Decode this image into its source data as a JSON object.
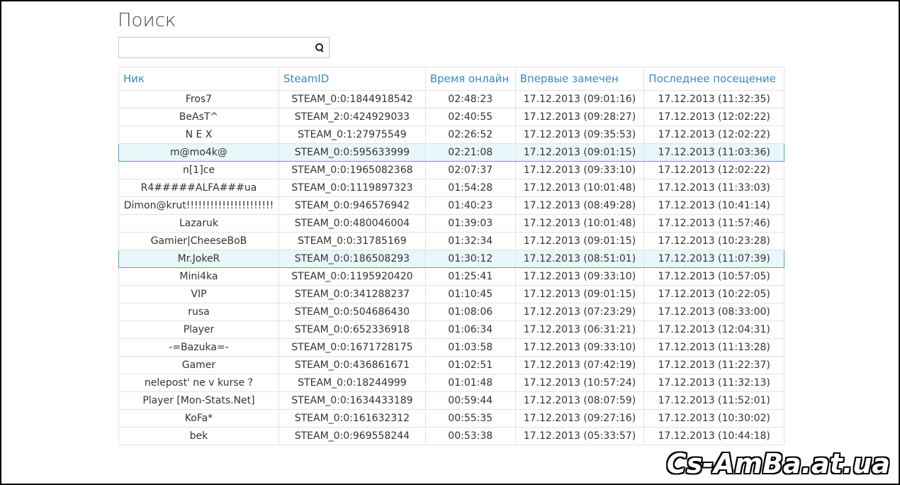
{
  "page": {
    "title": "Поиск"
  },
  "search": {
    "value": "",
    "placeholder": "",
    "icon": "search-icon"
  },
  "table": {
    "headers": [
      "Ник",
      "SteamID",
      "Время онлайн",
      "Впервые замечен",
      "Последнее посещение"
    ],
    "rows": [
      [
        "Fros7",
        "STEAM_0:0:1844918542",
        "02:48:23",
        "17.12.2013 (09:01:16)",
        "17.12.2013 (11:32:35)"
      ],
      [
        "BeAsT^",
        "STEAM_2:0:424929033",
        "02:40:55",
        "17.12.2013 (09:28:27)",
        "17.12.2013 (12:02:22)"
      ],
      [
        "N E X",
        "STEAM_0:1:27975549",
        "02:26:52",
        "17.12.2013 (09:35:53)",
        "17.12.2013 (12:02:22)"
      ],
      [
        "m@mo4k@",
        "STEAM_0:0:595633999",
        "02:21:08",
        "17.12.2013 (09:01:15)",
        "17.12.2013 (11:03:36)"
      ],
      [
        "n[1]ce",
        "STEAM_0:0:1965082368",
        "02:07:37",
        "17.12.2013 (09:33:10)",
        "17.12.2013 (12:02:22)"
      ],
      [
        "R4#####ALFA###ua",
        "STEAM_0:0:1119897323",
        "01:54:28",
        "17.12.2013 (10:01:48)",
        "17.12.2013 (11:33:03)"
      ],
      [
        "Dimon@krut!!!!!!!!!!!!!!!!!!!!!!",
        "STEAM_0:0:946576942",
        "01:40:23",
        "17.12.2013 (08:49:28)",
        "17.12.2013 (10:41:14)"
      ],
      [
        "Lazaruk",
        "STEAM_0:0:480046004",
        "01:39:03",
        "17.12.2013 (10:01:48)",
        "17.12.2013 (11:57:46)"
      ],
      [
        "Gamier|CheeseBoB",
        "STEAM_0:0:31785169",
        "01:32:34",
        "17.12.2013 (09:01:15)",
        "17.12.2013 (10:23:28)"
      ],
      [
        "Mr.JokeR",
        "STEAM_0:0:186508293",
        "01:30:12",
        "17.12.2013 (08:51:01)",
        "17.12.2013 (11:07:39)"
      ],
      [
        "Mini4ka",
        "STEAM_0:0:1195920420",
        "01:25:41",
        "17.12.2013 (09:33:10)",
        "17.12.2013 (10:57:05)"
      ],
      [
        "VIP",
        "STEAM_0:0:341288237",
        "01:10:45",
        "17.12.2013 (09:01:15)",
        "17.12.2013 (10:22:05)"
      ],
      [
        "rusa",
        "STEAM_0:0:504686430",
        "01:08:06",
        "17.12.2013 (07:23:29)",
        "17.12.2013 (08:33:00)"
      ],
      [
        "Player",
        "STEAM_0:0:652336918",
        "01:06:34",
        "17.12.2013 (06:31:21)",
        "17.12.2013 (12:04:31)"
      ],
      [
        "-=Bazuka=-",
        "STEAM_0:0:1671728175",
        "01:03:58",
        "17.12.2013 (09:33:10)",
        "17.12.2013 (11:13:28)"
      ],
      [
        "Gamer",
        "STEAM_0:0:436861671",
        "01:02:51",
        "17.12.2013 (07:42:19)",
        "17.12.2013 (11:22:37)"
      ],
      [
        "nelepost' ne v kurse ?",
        "STEAM_0:0:18244999",
        "01:01:48",
        "17.12.2013 (10:57:24)",
        "17.12.2013 (11:32:13)"
      ],
      [
        "Player [Mon-Stats.Net]",
        "STEAM_0:0:1634433189",
        "00:59:44",
        "17.12.2013 (08:07:59)",
        "17.12.2013 (11:52:01)"
      ],
      [
        "KoFa*",
        "STEAM_0:0:161632312",
        "00:55:35",
        "17.12.2013 (09:27:16)",
        "17.12.2013 (10:30:02)"
      ],
      [
        "bek",
        "STEAM_0:0:969558244",
        "00:53:38",
        "17.12.2013 (05:33:57)",
        "17.12.2013 (10:44:18)"
      ]
    ],
    "highlighted_rows": [
      3,
      9
    ]
  },
  "watermark": "Cs-AmBa.at.ua",
  "colors": {
    "header_text": "#3a8ac0",
    "highlight_bg": "#e9f7fa",
    "highlight_border": "#46a9c2"
  }
}
